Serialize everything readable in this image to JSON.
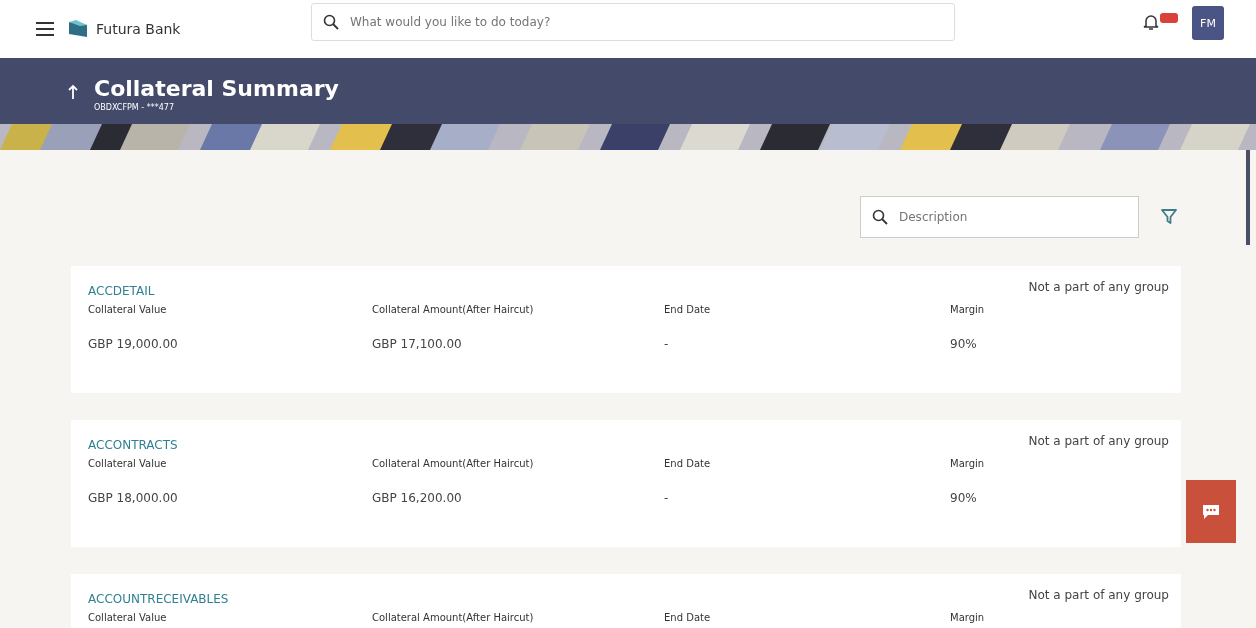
{
  "topbar": {
    "brand": "Futura Bank",
    "search": {
      "placeholder": "What would you like to do today?"
    },
    "avatar": "FM"
  },
  "header": {
    "title": "Collateral Summary",
    "subtitle": "OBDXCFPM - ***477"
  },
  "filter": {
    "placeholder": "Description"
  },
  "cards": [
    {
      "name": "ACCDETAIL",
      "group": "Not a part of any group",
      "fields": [
        {
          "label": "Collateral Value",
          "value": "GBP 19,000.00"
        },
        {
          "label": "Collateral Amount(After Haircut)",
          "value": "GBP 17,100.00"
        },
        {
          "label": "End Date",
          "value": "-"
        },
        {
          "label": "Margin",
          "value": "90%"
        }
      ]
    },
    {
      "name": "ACCONTRACTS",
      "group": "Not a part of any group",
      "fields": [
        {
          "label": "Collateral Value",
          "value": "GBP 18,000.00"
        },
        {
          "label": "Collateral Amount(After Haircut)",
          "value": "GBP 16,200.00"
        },
        {
          "label": "End Date",
          "value": "-"
        },
        {
          "label": "Margin",
          "value": "90%"
        }
      ]
    },
    {
      "name": "ACCOUNTRECEIVABLES",
      "group": "Not a part of any group",
      "fields": [
        {
          "label": "Collateral Value"
        },
        {
          "label": "Collateral Amount(After Haircut)"
        },
        {
          "label": "End Date"
        },
        {
          "label": "Margin"
        }
      ]
    }
  ]
}
